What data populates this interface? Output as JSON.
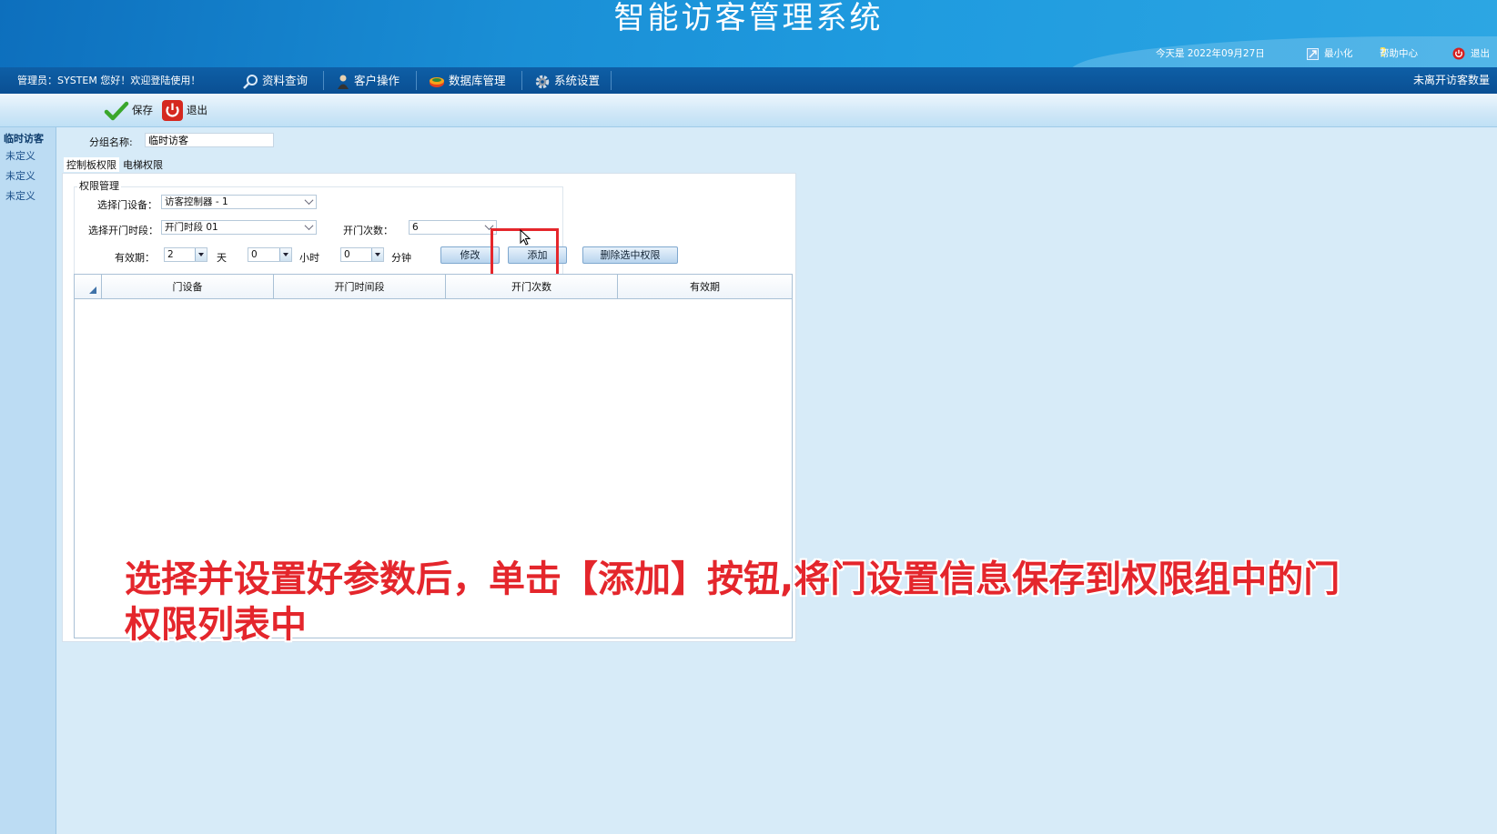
{
  "app": {
    "title": "智能访客管理系统"
  },
  "header": {
    "date_text": "今天是 2022年09月27日",
    "minimize_label": "最小化",
    "help_label": "帮助中心",
    "exit_label": "退出"
  },
  "menubar": {
    "admin_text": "管理员：SYSTEM 您好！欢迎登陆使用！",
    "items": [
      {
        "label": "资料查询",
        "icon": "magnifier-icon"
      },
      {
        "label": "客户操作",
        "icon": "user-icon"
      },
      {
        "label": "数据库管理",
        "icon": "database-icon"
      },
      {
        "label": "系统设置",
        "icon": "gear-icon"
      }
    ],
    "right_text": "未离开访客数量"
  },
  "toolbar": {
    "save_label": "保存",
    "exit_label": "退出"
  },
  "sidebar": {
    "group": "临时访客",
    "items": [
      "未定义",
      "未定义",
      "未定义"
    ]
  },
  "form": {
    "group_name_label": "分组名称:",
    "group_name_value": "临时访客",
    "tabs": [
      "控制板权限",
      "电梯权限"
    ],
    "perm_legend": "权限管理",
    "door_label": "选择门设备：",
    "door_value": "访客控制器 - 1",
    "period_label": "选择开门时段：",
    "period_value": "开门时段 01",
    "count_label": "开门次数：",
    "count_value": "6",
    "valid_label": "有效期：",
    "days_value": "2",
    "days_unit": "天",
    "hours_value": "0",
    "hours_unit": "小时",
    "minutes_value": "0",
    "minutes_unit": "分钟",
    "modify_label": "修改",
    "add_label": "添加",
    "delete_label": "删除选中权限"
  },
  "table": {
    "columns": [
      "门设备",
      "开门时间段",
      "开门次数",
      "有效期"
    ]
  },
  "caption": {
    "line1": "选择并设置好参数后，单击【添加】按钮,将门设置信息保存到权限组中的门",
    "line2": "权限列表中"
  },
  "colors": {
    "header_blue": "#1a8fd6",
    "menubar": "#0a4f93",
    "highlight": "#e5262b",
    "caption_red": "#e4262c"
  }
}
